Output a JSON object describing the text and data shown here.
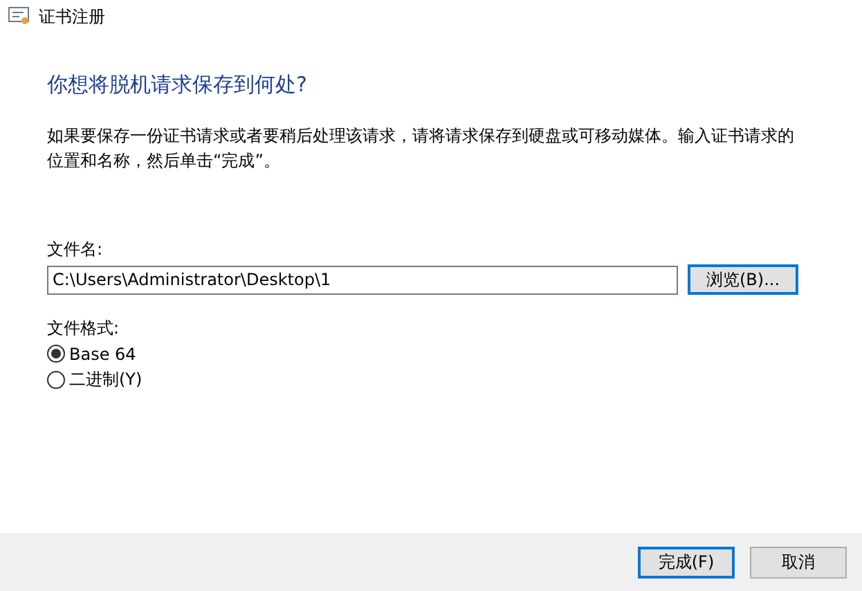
{
  "window": {
    "title": "证书注册"
  },
  "heading": "你想将脱机请求保存到何处?",
  "description": "如果要保存一份证书请求或者要稍后处理该请求，请将请求保存到硬盘或可移动媒体。输入证书请求的位置和名称，然后单击“完成”。",
  "file_name": {
    "label": "文件名:",
    "value": "C:\\Users\\Administrator\\Desktop\\1",
    "browse_button": "浏览(B)..."
  },
  "file_format": {
    "label": "文件格式:",
    "options": [
      {
        "label": "Base 64",
        "selected": true
      },
      {
        "label": "二进制(Y)",
        "selected": false
      }
    ]
  },
  "buttons": [
    {
      "label": "完成(F)",
      "default": true
    },
    {
      "label": "取消",
      "default": false
    }
  ]
}
